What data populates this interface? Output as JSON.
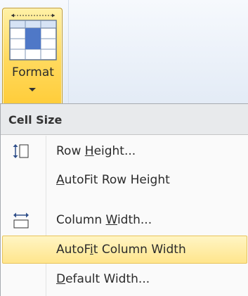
{
  "ribbon": {
    "format_button": {
      "label": "Format",
      "icon": "format-table-icon"
    }
  },
  "menu": {
    "section_header": "Cell Size",
    "items": [
      {
        "pre": "Row ",
        "key": "H",
        "post": "eight...",
        "icon": "row-height-icon",
        "highlighted": false
      },
      {
        "pre": "",
        "key": "A",
        "post": "utoFit Row Height",
        "icon": "",
        "highlighted": false
      },
      {
        "pre": "Column ",
        "key": "W",
        "post": "idth...",
        "icon": "column-width-icon",
        "highlighted": false
      },
      {
        "pre": "AutoF",
        "key": "i",
        "post": "t Column Width",
        "icon": "",
        "highlighted": true
      },
      {
        "pre": "",
        "key": "D",
        "post": "efault Width...",
        "icon": "",
        "highlighted": false
      }
    ]
  },
  "colors": {
    "highlight": "#ffe58c",
    "button_gold": "#ffd95d"
  }
}
